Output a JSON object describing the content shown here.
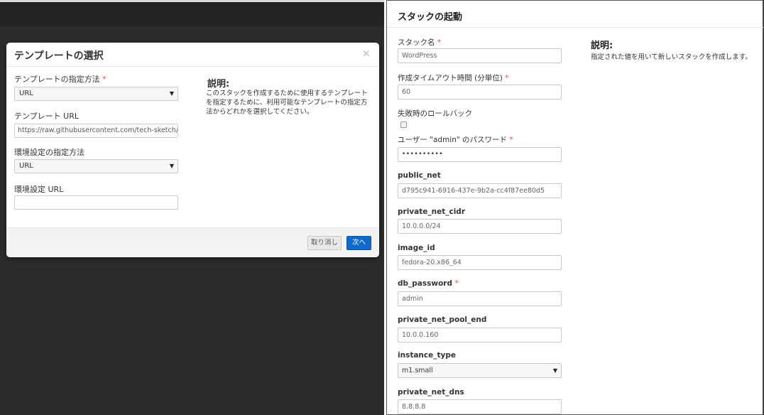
{
  "template_modal": {
    "title": "テンプレートの選択",
    "close_symbol": "×",
    "template_source_label": "テンプレートの指定方法",
    "required_mark": "*",
    "template_source_value": "URL",
    "template_url_label": "テンプレート URL",
    "template_url_value": "https://raw.githubusercontent.com/tech-sketch/heat_sa",
    "env_source_label": "環境設定の指定方法",
    "env_source_value": "URL",
    "env_url_label": "環境設定 URL",
    "env_url_value": "",
    "description_title": "説明:",
    "description_text": "このスタックを作成するために使用するテンプレートを指定するために、利用可能なテンプレートの指定方法からどれかを選択してください。",
    "cancel_label": "取り消し",
    "next_label": "次へ"
  },
  "launch_stack": {
    "title": "スタックの起動",
    "description_title": "説明:",
    "description_text": "指定された値を用いて新しいスタックを作成します。",
    "required_mark": "*",
    "fields": {
      "stack_name": {
        "label": "スタック名",
        "value": "WordPress"
      },
      "timeout": {
        "label": "作成タイムアウト時間 (分単位)",
        "value": "60"
      },
      "rollback": {
        "label": "失敗時のロールバック",
        "checked": false
      },
      "password": {
        "label": "ユーザー \"admin\" のパスワード",
        "value": "••••••••••"
      },
      "public_net": {
        "label": "public_net",
        "value": "d795c941-6916-437e-9b2a-cc4f87ee80d5"
      },
      "private_net_cidr": {
        "label": "private_net_cidr",
        "value": "10.0.0.0/24"
      },
      "image_id": {
        "label": "image_id",
        "value": "fedora-20.x86_64"
      },
      "db_password": {
        "label": "db_password",
        "value": "admin"
      },
      "private_net_pool_end": {
        "label": "private_net_pool_end",
        "value": "10.0.0.160"
      },
      "instance_type": {
        "label": "instance_type",
        "value": "m1.small"
      },
      "private_net_dns": {
        "label": "private_net_dns",
        "value": "8.8.8.8"
      }
    }
  },
  "colors": {
    "primary_button": "#1068c8",
    "required": "#d9534f",
    "backdrop": "#2c2c2c"
  }
}
